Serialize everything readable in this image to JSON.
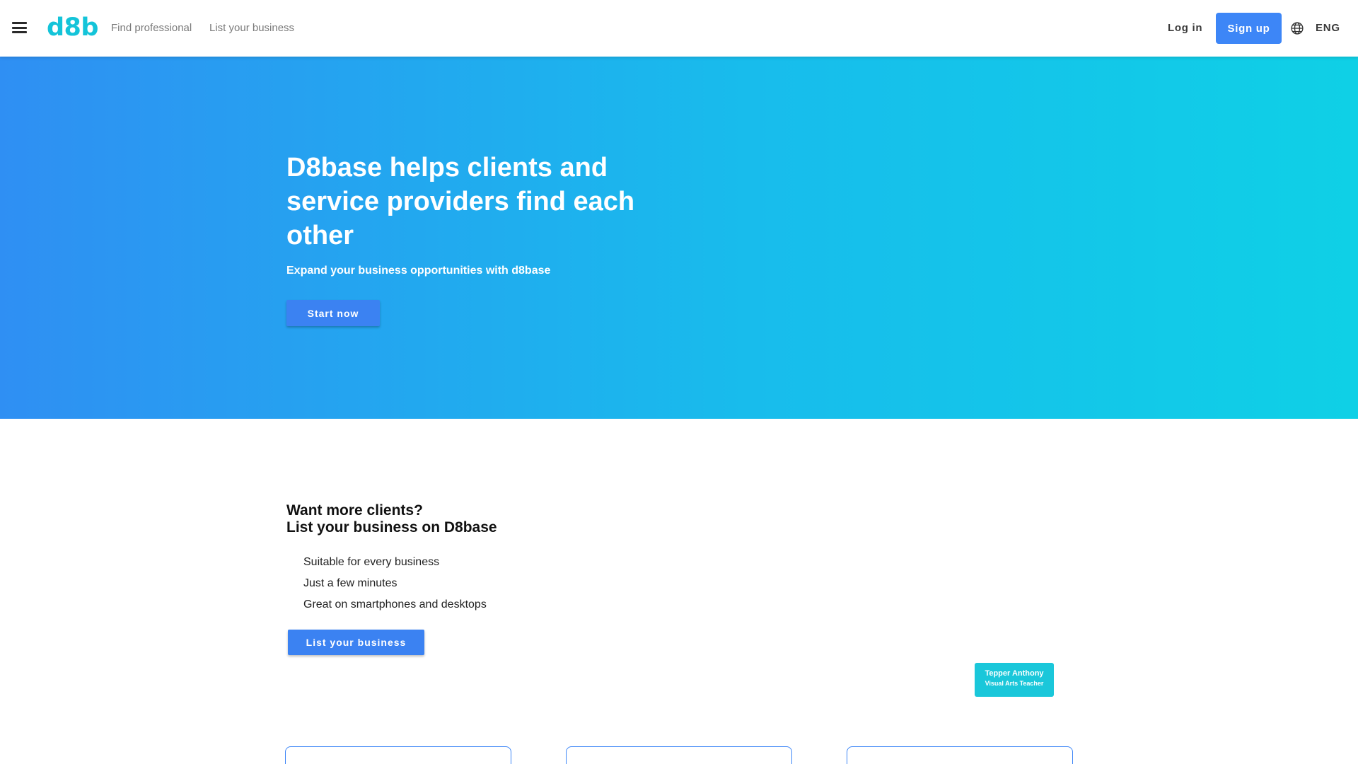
{
  "header": {
    "logo_text": "d8b",
    "nav": {
      "find_professional": "Find professional",
      "list_your_business": "List your business"
    },
    "login_label": "Log in",
    "signup_label": "Sign up",
    "language": "ENG",
    "icons": {
      "menu": "hamburger-menu-icon",
      "language": "globe-icon"
    }
  },
  "hero": {
    "title": "D8base helps clients and service providers find each other",
    "subtitle": "Expand your business opportunities with d8base",
    "cta_label": "Start now"
  },
  "business_section": {
    "title_line1": "Want more clients?",
    "title_line2": "List your business on D8base",
    "features": [
      "Suitable for every business",
      "Just a few minutes",
      "Great on smartphones and desktops"
    ],
    "cta_label": "List your business"
  },
  "showcase": {
    "person_name": "Tepper Anthony",
    "person_role": "Visual Arts Teacher"
  },
  "colors": {
    "brand": "#14c4d9",
    "primary_button": "#3d86f7",
    "hero_gradient_start": "#2f8ff3",
    "hero_gradient_end": "#0fd0e6",
    "person_card": "#1ac7da"
  }
}
